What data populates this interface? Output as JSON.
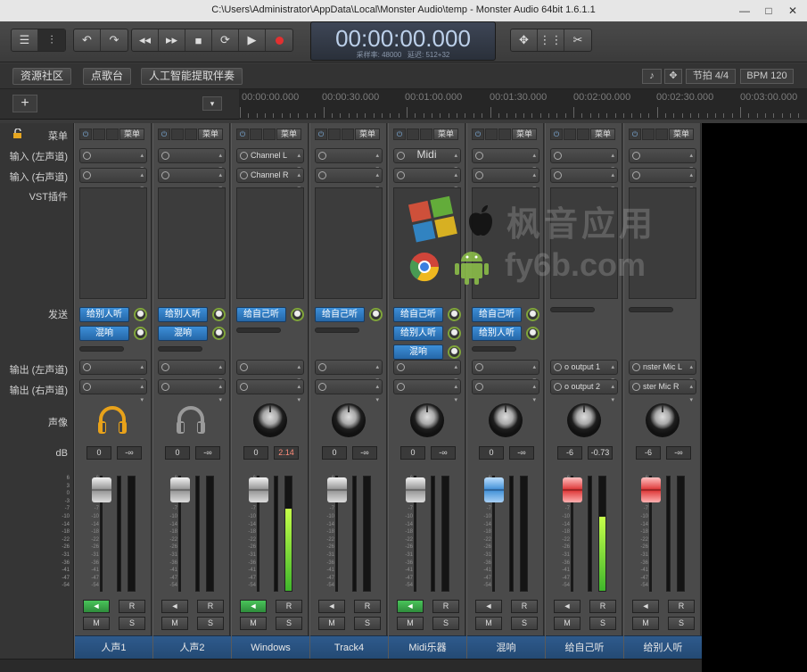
{
  "window": {
    "title": "C:\\Users\\Administrator\\AppData\\Local\\Monster Audio\\temp - Monster Audio 64bit 1.6.1.1",
    "minimize": "—",
    "maximize": "□",
    "close": "✕"
  },
  "transport": {
    "time": "00:00:00.000",
    "sample_rate_label": "采样率: 48000",
    "latency_label": "延迟: 512+32"
  },
  "nav_tabs": [
    "资源社区",
    "点歌台",
    "人工智能提取伴奏"
  ],
  "toolbar_right": {
    "beat_label": "节拍",
    "beat_value": "4/4",
    "bpm_label": "BPM",
    "bpm_value": "120"
  },
  "add_track": "+",
  "ruler": {
    "marks": [
      "00:00:00.000",
      "00:00:30.000",
      "00:01:00.000",
      "00:01:30.000",
      "00:02:00.000",
      "00:02:30.000",
      "00:03:00.000"
    ]
  },
  "row_labels": {
    "menu": "菜单",
    "input_left": "输入 (左声道)",
    "input_right": "输入 (右声道)",
    "vst": "VST插件",
    "send": "发送",
    "output_left": "输出 (左声道)",
    "output_right": "输出 (右声道)",
    "pan": "声像",
    "db": "dB"
  },
  "db_scale": [
    "6",
    "3",
    "0",
    "-3",
    "-7",
    "-10",
    "-14",
    "-18",
    "-22",
    "-26",
    "-31",
    "-36",
    "-41",
    "-47",
    "-54"
  ],
  "header_menu_label": "菜单",
  "button_labels": {
    "record": "R",
    "mute": "M",
    "solo": "S",
    "speaker": "◄"
  },
  "channels": [
    {
      "name": "人声1",
      "input_l": "",
      "input_r": "",
      "midi": "",
      "sends": [
        "给别人听",
        "混响"
      ],
      "output_l": "",
      "output_r": "",
      "pan_type": "headphone",
      "hp_color": "#e8a21a",
      "vol": "0",
      "peak": "-∞",
      "fader": "gray",
      "level": 0,
      "speaker_on": true
    },
    {
      "name": "人声2",
      "input_l": "",
      "input_r": "",
      "midi": "",
      "sends": [
        "给别人听",
        "混响"
      ],
      "output_l": "",
      "output_r": "",
      "pan_type": "headphone",
      "hp_color": "#9a9a9a",
      "vol": "0",
      "peak": "-∞",
      "fader": "gray",
      "level": 0,
      "speaker_on": false
    },
    {
      "name": "Windows",
      "input_l": "Channel L",
      "input_r": "Channel R",
      "midi": "",
      "sends": [
        "给自己听"
      ],
      "output_l": "",
      "output_r": "",
      "pan_type": "knob",
      "vol": "0",
      "peak": "2.14",
      "peak_hot": true,
      "fader": "gray",
      "level": 0.72,
      "speaker_on": true
    },
    {
      "name": "Track4",
      "input_l": "",
      "input_r": "",
      "midi": "",
      "sends": [
        "给自己听"
      ],
      "output_l": "",
      "output_r": "",
      "pan_type": "knob",
      "vol": "0",
      "peak": "-∞",
      "fader": "gray",
      "level": 0,
      "speaker_on": false
    },
    {
      "name": "Midi乐器",
      "input_l": "",
      "input_r": "",
      "midi": "Midi",
      "sends": [
        "给自己听",
        "给别人听",
        "混响"
      ],
      "output_l": "",
      "output_r": "",
      "pan_type": "knob",
      "vol": "0",
      "peak": "-∞",
      "fader": "gray",
      "level": 0,
      "speaker_on": true
    },
    {
      "name": "混响",
      "input_l": "",
      "input_r": "",
      "midi": "",
      "sends": [
        "给自己听",
        "给别人听"
      ],
      "output_l": "",
      "output_r": "",
      "pan_type": "knob",
      "vol": "0",
      "peak": "-∞",
      "fader": "blue",
      "level": 0,
      "speaker_on": false
    },
    {
      "name": "给自己听",
      "input_l": "",
      "input_r": "",
      "midi": "",
      "sends": [],
      "output_l": "o output 1",
      "output_r": "o output 2",
      "pan_type": "knob",
      "vol": "-6",
      "peak": "-0.73",
      "fader": "red",
      "level": 0.65,
      "speaker_on": false
    },
    {
      "name": "给别人听",
      "input_l": "",
      "input_r": "",
      "midi": "",
      "sends": [],
      "output_l": "nster Mic L",
      "output_r": "ster Mic R",
      "pan_type": "knob",
      "vol": "-6",
      "peak": "-∞",
      "fader": "red",
      "level": 0,
      "speaker_on": false
    }
  ],
  "watermark": {
    "line1": "枫音应用",
    "line2": "fy6b.com"
  },
  "colors": {
    "send_blue": "#2f7bc4",
    "channel_name_bg": "#2a527f",
    "meter_green": "#4fc13a",
    "speaker_green": "#3cae4c"
  }
}
